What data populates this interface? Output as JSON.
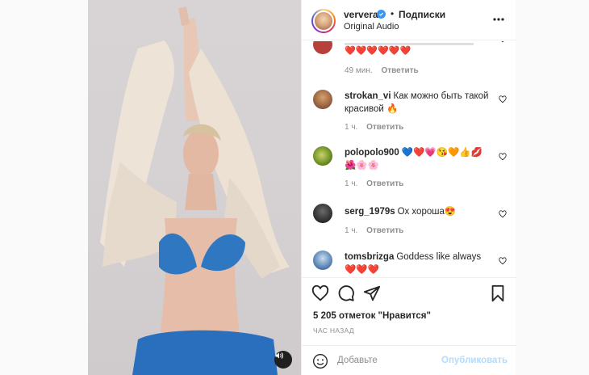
{
  "header": {
    "username": "ververa",
    "separator": "•",
    "follow_status": "Подписки",
    "audio": "Original Audio"
  },
  "comments": [
    {
      "username": "",
      "text": "❤️❤️❤️❤️❤️❤️",
      "time": "49 мин.",
      "reply": "Ответить",
      "avatar_color": "#c0392b"
    },
    {
      "username": "strokan_vi",
      "text": "Как можно быть такой красивой 🔥",
      "time": "1 ч.",
      "reply": "Ответить",
      "avatar_color": "#8a5a3c"
    },
    {
      "username": "polopolo900",
      "text": "💙❤️💗😘🧡👍💋🌺🌸🌸",
      "time": "1 ч.",
      "reply": "Ответить",
      "avatar_color": "#6b8e23"
    },
    {
      "username": "serg_1979s",
      "text": "Ох хороша😍",
      "time": "1 ч.",
      "reply": "Ответить",
      "avatar_color": "#3a3a3a"
    },
    {
      "username": "tomsbrizga",
      "text": "Goddess like always ❤️❤️❤️",
      "time": "",
      "reply": "",
      "avatar_color": "#5b86b5"
    }
  ],
  "likes": "5 205 отметок \"Нравится\"",
  "time_ago": "ЧАС НАЗАД",
  "composer": {
    "placeholder": "Добавьте",
    "publish_label": "Опубликовать"
  },
  "colors": {
    "accent": "#3897f0",
    "muted": "#8e8e8e",
    "publish_disabled": "#b3dbff",
    "text": "#262626"
  },
  "icons": [
    "heart-icon",
    "comment-icon",
    "share-icon",
    "bookmark-icon",
    "emoji-icon",
    "more-icon",
    "volume-icon",
    "verified-icon"
  ]
}
